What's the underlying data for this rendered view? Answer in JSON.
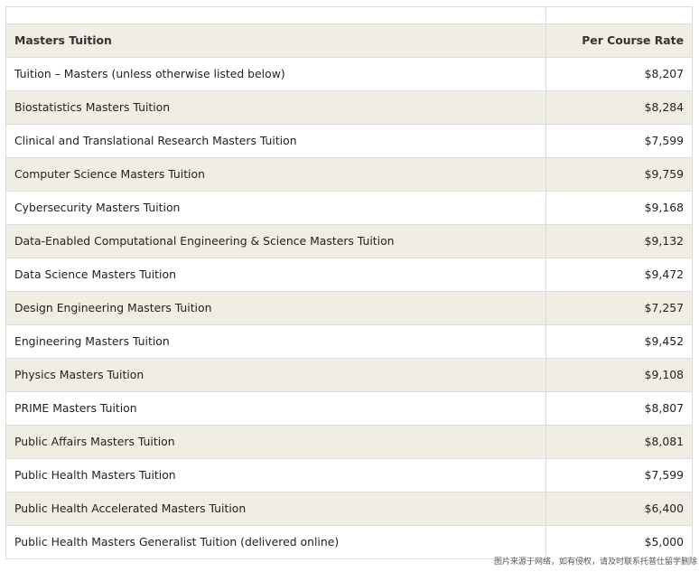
{
  "table": {
    "header": {
      "name": "Masters Tuition",
      "rate": "Per Course Rate"
    },
    "rows": [
      {
        "name": "Tuition – Masters (unless otherwise listed below)",
        "rate": "$8,207"
      },
      {
        "name": "Biostatistics Masters Tuition",
        "rate": "$8,284"
      },
      {
        "name": "Clinical and Translational Research Masters Tuition",
        "rate": "$7,599"
      },
      {
        "name": "Computer Science Masters Tuition",
        "rate": "$9,759"
      },
      {
        "name": "Cybersecurity Masters Tuition",
        "rate": "$9,168"
      },
      {
        "name": "Data-Enabled Computational Engineering & Science Masters Tuition",
        "rate": "$9,132"
      },
      {
        "name": "Data Science Masters Tuition",
        "rate": "$9,472"
      },
      {
        "name": "Design Engineering Masters Tuition",
        "rate": "$7,257"
      },
      {
        "name": "Engineering Masters Tuition",
        "rate": "$9,452"
      },
      {
        "name": "Physics Masters Tuition",
        "rate": "$9,108"
      },
      {
        "name": "PRIME Masters Tuition",
        "rate": "$8,807"
      },
      {
        "name": "Public Affairs Masters Tuition",
        "rate": "$8,081"
      },
      {
        "name": "Public Health Masters Tuition",
        "rate": "$7,599"
      },
      {
        "name": "Public Health Accelerated Masters Tuition",
        "rate": "$6,400"
      },
      {
        "name": "Public Health Masters Generalist Tuition (delivered online)",
        "rate": "$5,000"
      }
    ]
  },
  "watermark": "图片来源于网络，如有侵权，请及时联系托普仕留学删除",
  "colors": {
    "shaded_row": "#efede4",
    "border": "#dcdcdc",
    "text": "#222222"
  }
}
